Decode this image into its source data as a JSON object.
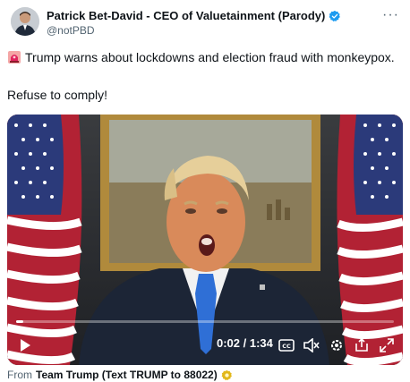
{
  "author": {
    "display_name": "Patrick Bet-David - CEO of Valuetainment (Parody)",
    "handle": "@notPBD",
    "verified_color": "#1d9bf0"
  },
  "tweet": {
    "line1": "Trump warns about lockdowns and election fraud with monkeypox.",
    "line2": "Refuse to comply!"
  },
  "video": {
    "time": "0:02 / 1:34",
    "progress_fraction": 0.02,
    "icons": [
      "play-icon",
      "captions-icon",
      "mute-icon",
      "settings-icon",
      "pop-out-icon",
      "fullscreen-icon"
    ]
  },
  "footer": {
    "from_label": "From",
    "source": "Team Trump (Text TRUMP to 88022)"
  }
}
